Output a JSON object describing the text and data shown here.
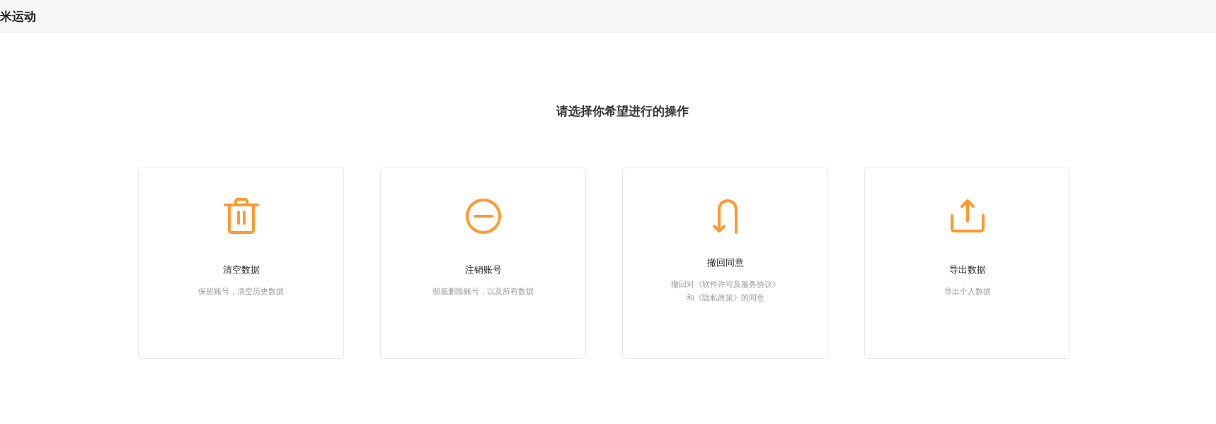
{
  "header": {
    "title": "米运动"
  },
  "heading": "请选择你希望进行的操作",
  "cards": [
    {
      "kind": "trash",
      "title": "清空数据",
      "description": "保留账号，清空历史数据"
    },
    {
      "kind": "minus-circle",
      "title": "注销账号",
      "description": "彻底删除账号，以及所有数据"
    },
    {
      "kind": "u-turn",
      "title": "撤回同意",
      "description_lines": [
        "撤回对《软件许可及服务协议》",
        "和《隐私政策》的同意"
      ]
    },
    {
      "kind": "upload",
      "title": "导出数据",
      "description": "导出个人数据"
    }
  ]
}
